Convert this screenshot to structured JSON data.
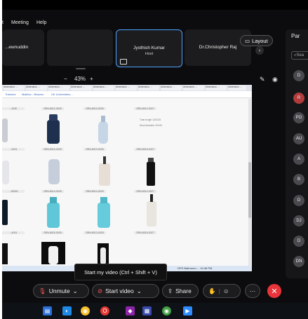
{
  "menu": {
    "items": [
      "Meeting",
      "Help"
    ],
    "partial_left": "t"
  },
  "tiles": [
    {
      "name": "...ewnuddin",
      "role": ""
    },
    {
      "name": "",
      "role": ""
    },
    {
      "name": "Jyothish Kumar",
      "role": "Host"
    },
    {
      "name": "Dr.Christopher Raj",
      "role": ""
    }
  ],
  "layout_button": {
    "label": "Layout",
    "icon": "layout-icon"
  },
  "zoom": {
    "minus": "−",
    "value": "43%",
    "plus": "+"
  },
  "shared_screen": {
    "tabs": [
      "dimension ...",
      "dimension ...",
      "dimension ...",
      "dimension ...",
      "dimension ...",
      "dimension ...",
      "dimension ...",
      "dimension ...",
      "dimension ...",
      "dimension ...",
      "dimension ..."
    ],
    "bookmarks": [
      "Trainees",
      "Mailbox - Bhavan..",
      "UK Universities..."
    ],
    "captions": [
      [
        "...ODE",
        "SRN-8012-0025",
        "SRN-8013-0026",
        "SRN-8012-0027"
      ],
      [
        "...4001",
        "SRN-8015-0025",
        "SRN-8013-0026",
        "SRN-8015-0027"
      ],
      [
        "...30025",
        "SRN-8014-0025",
        "SRN-8014-0025",
        "SRN-8012-0027"
      ],
      [
        "...4001",
        "SRN-8015-0025",
        "SRN-8013-0026",
        "SRN-8015-0027"
      ]
    ],
    "spec_text": [
      "Tube length  100/125",
      "Neck diameter  20/410"
    ],
    "taskbar_right": "DPS Bathroom  ...  10:48 PM"
  },
  "panel": {
    "title": "Par",
    "search_placeholder": "Sea",
    "avatars": [
      "D",
      "R",
      "PO",
      "AU",
      "A",
      "B",
      "D",
      "DJ",
      "D",
      "DN"
    ]
  },
  "tooltip": "Start my video (Ctrl + Shift + V)",
  "controls": {
    "unmute": "Unmute",
    "start_video": "Start video",
    "share": "Share",
    "more": "···",
    "end": "✕"
  },
  "colors": {
    "accent": "#4da3ff",
    "end_call": "#e8343a",
    "muted": "#ff5a5a"
  }
}
